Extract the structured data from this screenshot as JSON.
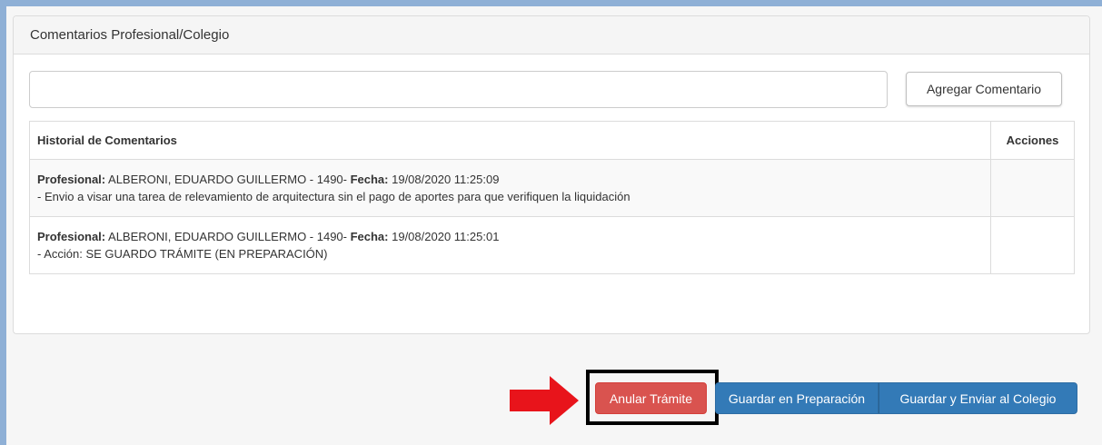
{
  "panel": {
    "title": "Comentarios Profesional/Colegio",
    "comment_input": {
      "value": "",
      "placeholder": ""
    },
    "add_button_label": "Agregar Comentario"
  },
  "table": {
    "headers": {
      "history": "Historial de Comentarios",
      "actions": "Acciones"
    },
    "rows": [
      {
        "profesional_label": "Profesional:",
        "profesional_value": " ALBERONI, EDUARDO GUILLERMO - 1490- ",
        "fecha_label": "Fecha:",
        "fecha_value": " 19/08/2020 11:25:09",
        "comment": "- Envio a visar una tarea de relevamiento de arquitectura sin el pago de aportes para que verifiquen la liquidación"
      },
      {
        "profesional_label": "Profesional:",
        "profesional_value": " ALBERONI, EDUARDO GUILLERMO - 1490- ",
        "fecha_label": "Fecha:",
        "fecha_value": " 19/08/2020 11:25:01",
        "comment": "- Acción: SE GUARDO TRÁMITE (EN PREPARACIÓN)"
      }
    ]
  },
  "actions": {
    "cancel_label": "Anular Trámite",
    "save_prep_label": "Guardar en Preparación",
    "save_send_label": "Guardar y Enviar al Colegio"
  },
  "annotation": {
    "arrow_icon": "red-arrow-right-icon",
    "arrow_color": "#e8141b",
    "box_color": "#000000"
  },
  "colors": {
    "danger": "#d9534f",
    "primary": "#337ab7",
    "frame": "#8fb0d6"
  }
}
